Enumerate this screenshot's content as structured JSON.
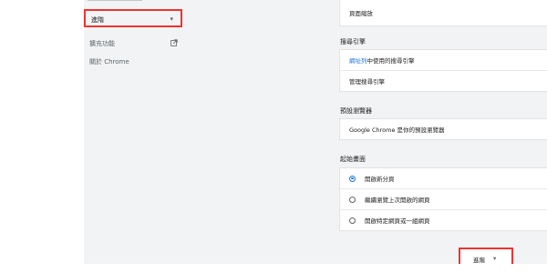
{
  "sidebar": {
    "advanced_label": "進階",
    "extensions_label": "擴充功能",
    "about_label": "關於 Chrome",
    "icons": {
      "chevron": "chevron-down-icon",
      "external": "open-in-new-icon"
    }
  },
  "top_card": {
    "text": "頁面縮放"
  },
  "search_engine": {
    "title": "搜尋引擎",
    "row1_link": "網址列",
    "row1_rest": "中使用的搜尋引擎",
    "row2": "管理搜尋引擎"
  },
  "default_browser": {
    "title": "預設瀏覽器",
    "row": "Google Chrome 是你的預設瀏覽器"
  },
  "startup": {
    "title": "起始畫面",
    "options": [
      {
        "label": "開啟新分頁",
        "checked": true
      },
      {
        "label": "繼續瀏覽上次開啟的網頁",
        "checked": false
      },
      {
        "label": "開啟特定網頁或一組網頁",
        "checked": false
      }
    ]
  },
  "advanced_button": {
    "label": "進階"
  },
  "colors": {
    "accent": "#1a73e8",
    "highlight_border": "#e33333",
    "background": "#f1f3f4"
  }
}
